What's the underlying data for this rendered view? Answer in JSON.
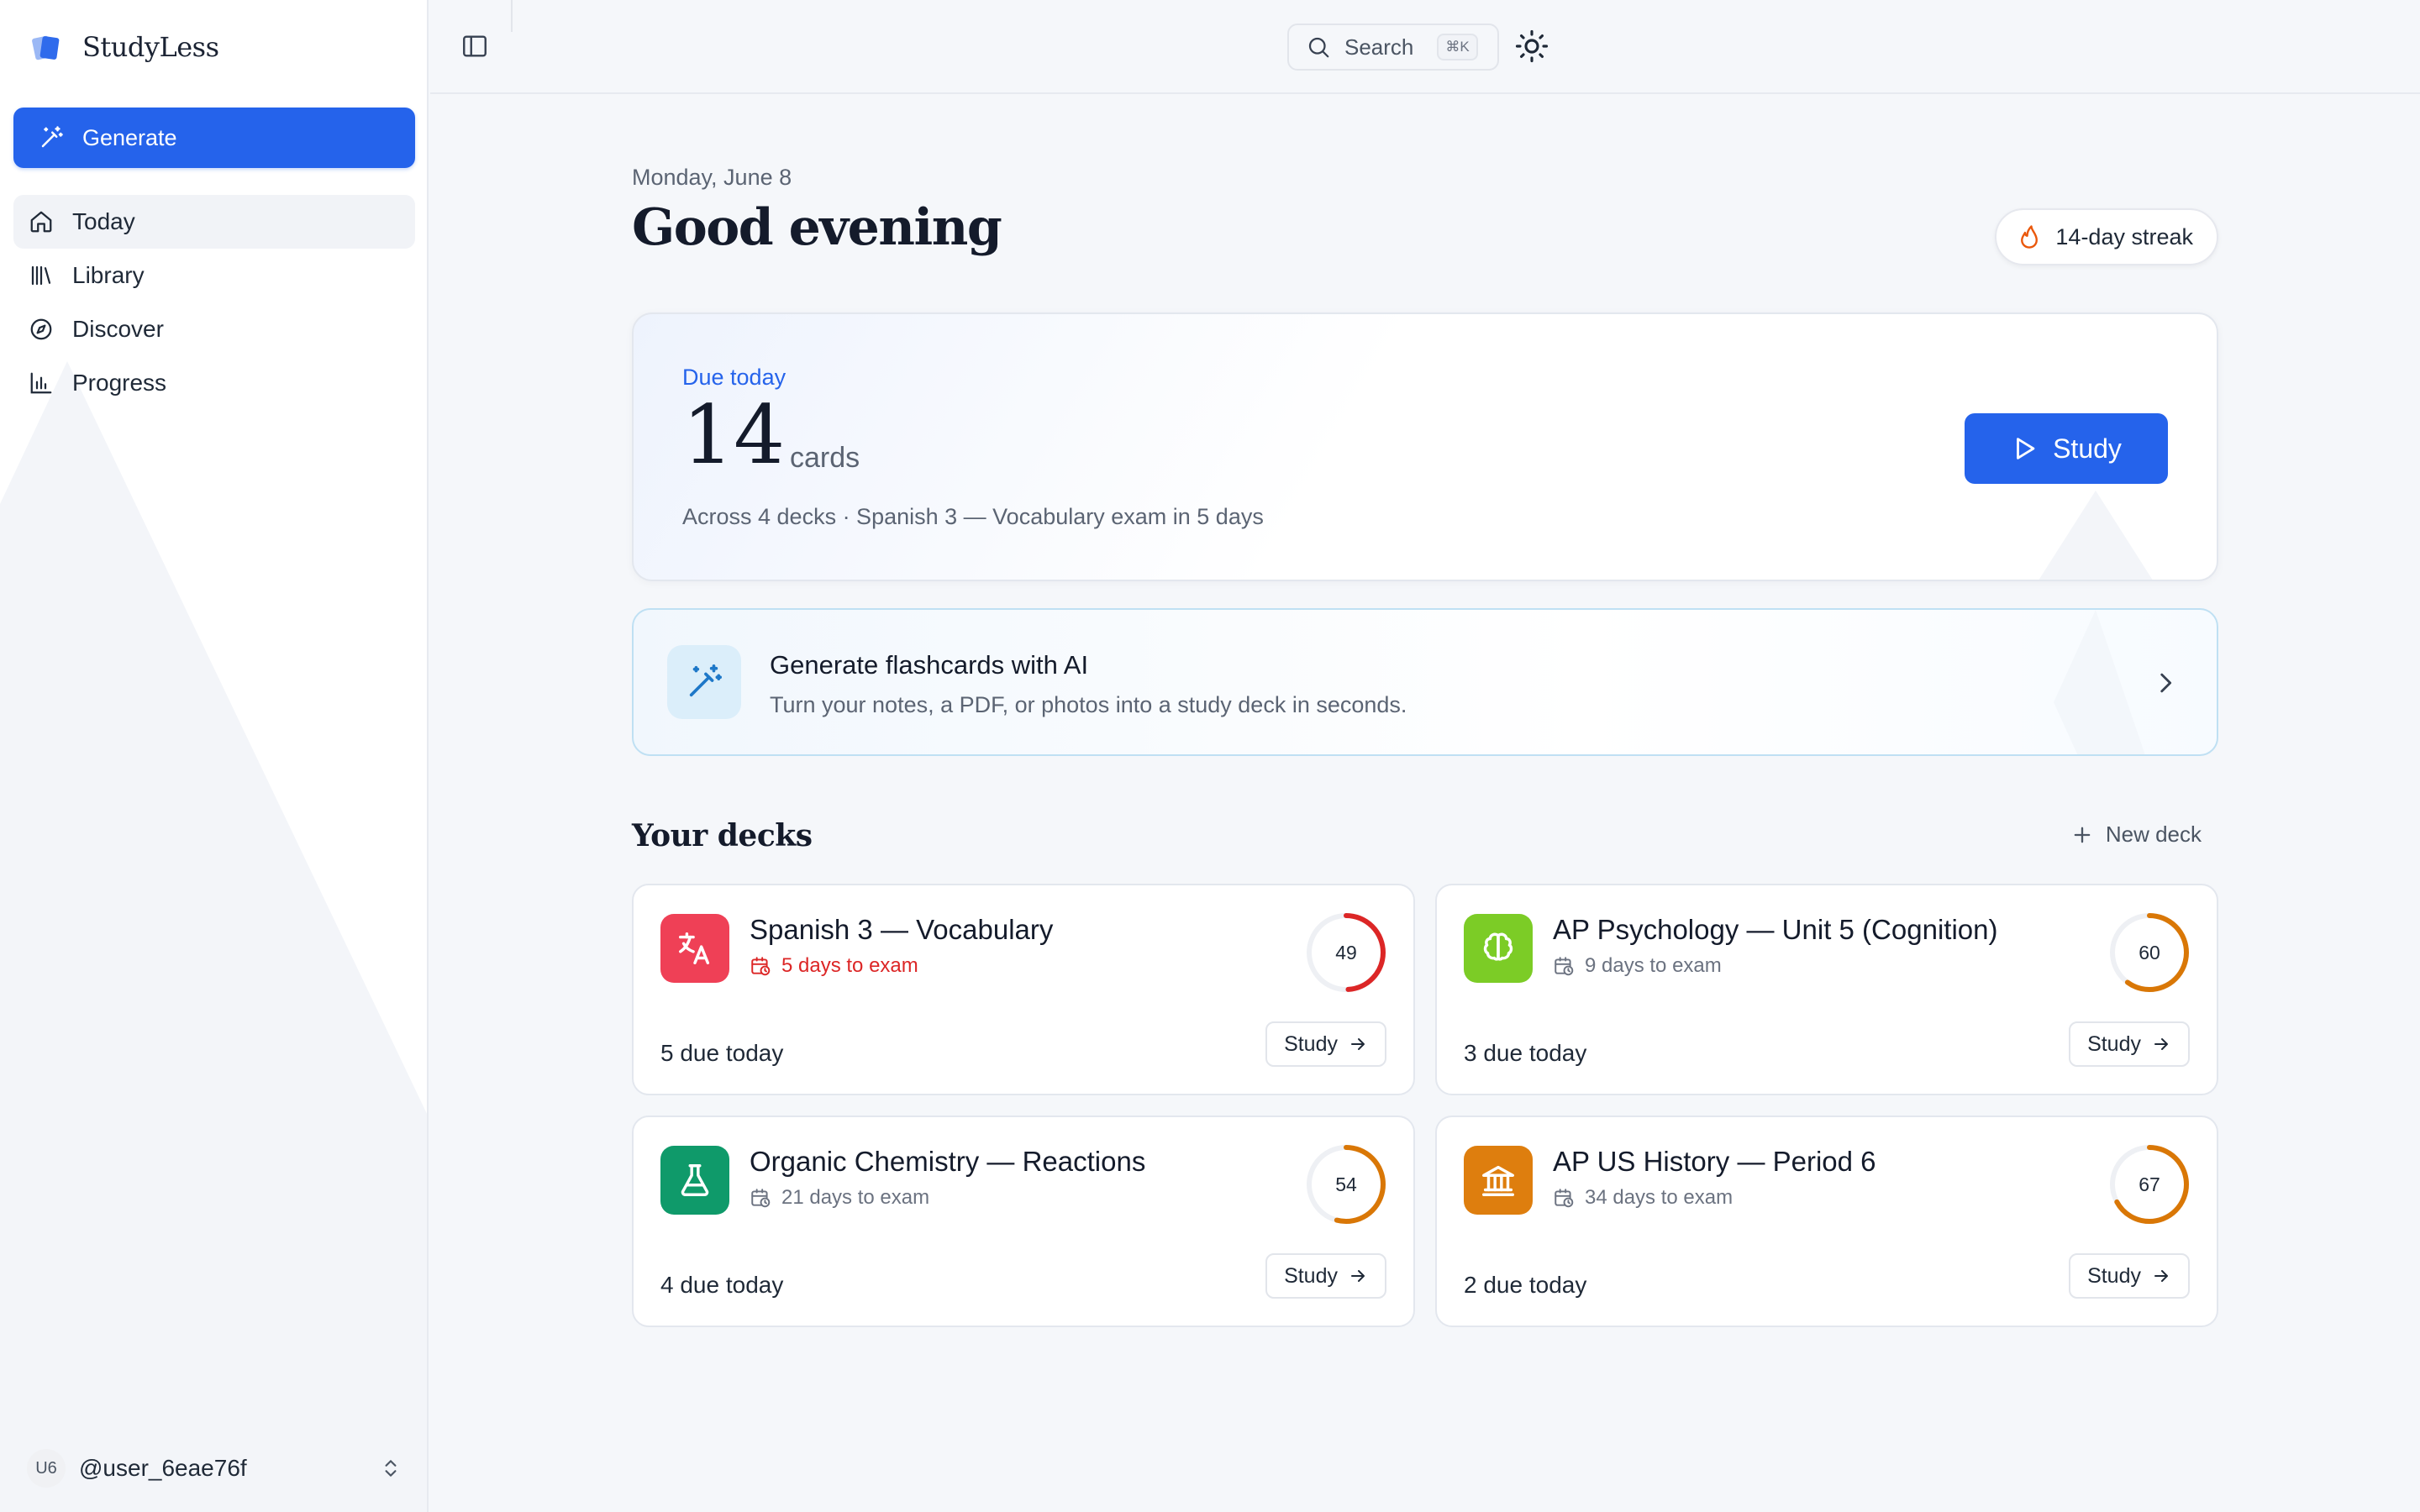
{
  "app": {
    "name": "StudyLess"
  },
  "sidebar": {
    "generate_label": "Generate",
    "items": [
      {
        "label": "Today",
        "icon": "home-icon",
        "active": true
      },
      {
        "label": "Library",
        "icon": "library-icon",
        "active": false
      },
      {
        "label": "Discover",
        "icon": "compass-icon",
        "active": false
      },
      {
        "label": "Progress",
        "icon": "bar-chart-icon",
        "active": false
      }
    ],
    "user": {
      "initials": "U6",
      "handle": "@user_6eae76f"
    }
  },
  "topbar": {
    "search_label": "Search",
    "search_shortcut": "⌘K"
  },
  "header": {
    "date": "Monday, June 8",
    "greeting": "Good evening",
    "streak": "14-day streak"
  },
  "due": {
    "label": "Due today",
    "count": "14",
    "unit": "cards",
    "description": "Across 4 decks · Spanish 3 — Vocabulary exam in 5 days",
    "study_label": "Study"
  },
  "ai_card": {
    "title": "Generate flashcards with AI",
    "subtitle": "Turn your notes, a PDF, or photos into a study deck in seconds."
  },
  "decks_section": {
    "title": "Your decks",
    "new_deck_label": "New deck"
  },
  "decks": [
    {
      "title": "Spanish 3 — Vocabulary",
      "exam": "5 days to exam",
      "urgent": true,
      "score": 49,
      "due": "5 due today",
      "study": "Study",
      "icon": "translate-icon",
      "color": "#ef4056",
      "ring_color": "#dc2626"
    },
    {
      "title": "AP Psychology — Unit 5 (Cognition)",
      "exam": "9 days to exam",
      "urgent": false,
      "score": 60,
      "due": "3 due today",
      "study": "Study",
      "icon": "brain-icon",
      "color": "#7ccc26",
      "ring_color": "#d97706"
    },
    {
      "title": "Organic Chemistry — Reactions",
      "exam": "21 days to exam",
      "urgent": false,
      "score": 54,
      "due": "4 due today",
      "study": "Study",
      "icon": "flask-icon",
      "color": "#0f9a6a",
      "ring_color": "#d97706"
    },
    {
      "title": "AP US History — Period 6",
      "exam": "34 days to exam",
      "urgent": false,
      "score": 67,
      "due": "2 due today",
      "study": "Study",
      "icon": "landmark-icon",
      "color": "#de7e0e",
      "ring_color": "#d97706"
    }
  ],
  "colors": {
    "accent": "#2563eb",
    "urgent": "#dc2626",
    "warning": "#d97706"
  }
}
